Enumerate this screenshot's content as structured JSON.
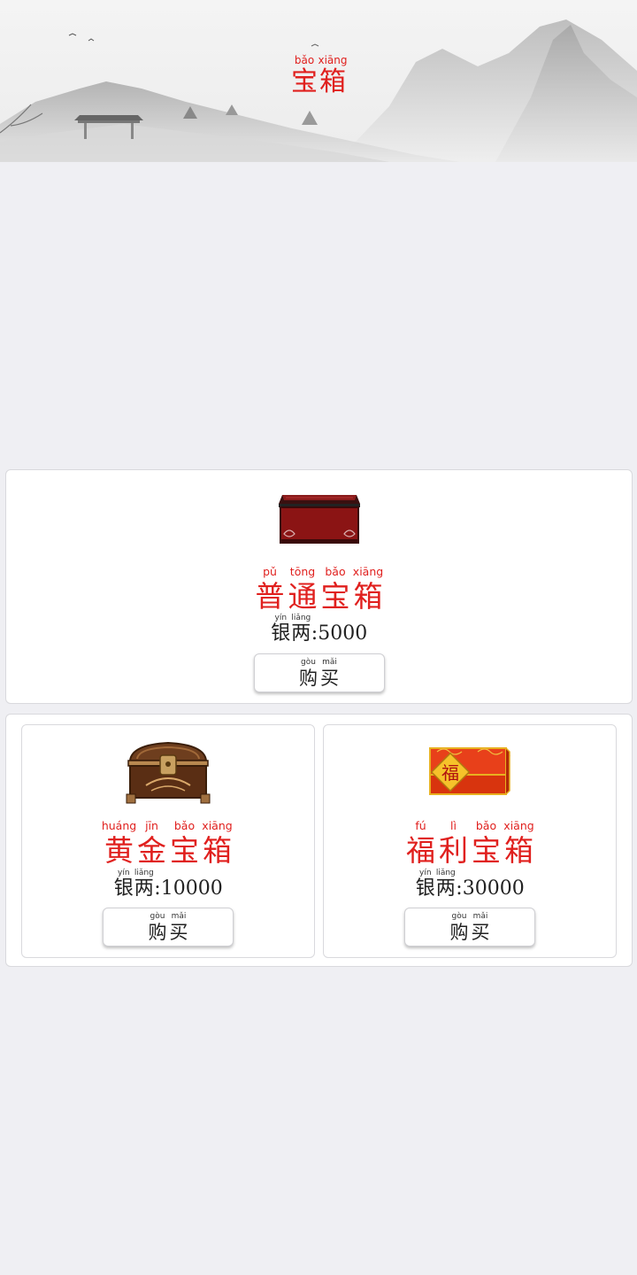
{
  "header": {
    "title": [
      {
        "py": "bǎo",
        "hz": "宝"
      },
      {
        "py": "xiāng",
        "hz": "箱"
      }
    ]
  },
  "chests": [
    {
      "name": [
        {
          "py": "pǔ",
          "hz": "普"
        },
        {
          "py": "tōng",
          "hz": "通"
        },
        {
          "py": "bǎo",
          "hz": "宝"
        },
        {
          "py": "xiāng",
          "hz": "箱"
        }
      ],
      "price_label": [
        {
          "py": "yín",
          "hz": "银"
        },
        {
          "py": "liǎng",
          "hz": "两"
        }
      ],
      "price_sep": ":",
      "price": "5000",
      "buy": [
        {
          "py": "gòu",
          "hz": "购"
        },
        {
          "py": "mǎi",
          "hz": "买"
        }
      ],
      "icon": "red-chest-icon"
    },
    {
      "name": [
        {
          "py": "huáng",
          "hz": "黄"
        },
        {
          "py": "jīn",
          "hz": "金"
        },
        {
          "py": "bǎo",
          "hz": "宝"
        },
        {
          "py": "xiāng",
          "hz": "箱"
        }
      ],
      "price_label": [
        {
          "py": "yín",
          "hz": "银"
        },
        {
          "py": "liǎng",
          "hz": "两"
        }
      ],
      "price_sep": ":",
      "price": "10000",
      "buy": [
        {
          "py": "gòu",
          "hz": "购"
        },
        {
          "py": "mǎi",
          "hz": "买"
        }
      ],
      "icon": "wooden-chest-icon"
    },
    {
      "name": [
        {
          "py": "fú",
          "hz": "福"
        },
        {
          "py": "lì",
          "hz": "利"
        },
        {
          "py": "bǎo",
          "hz": "宝"
        },
        {
          "py": "xiāng",
          "hz": "箱"
        }
      ],
      "price_label": [
        {
          "py": "yín",
          "hz": "银"
        },
        {
          "py": "liǎng",
          "hz": "两"
        }
      ],
      "price_sep": ":",
      "price": "30000",
      "buy": [
        {
          "py": "gòu",
          "hz": "购"
        },
        {
          "py": "mǎi",
          "hz": "买"
        }
      ],
      "icon": "fortune-box-icon",
      "emblem": "福"
    }
  ],
  "colors": {
    "accent_red": "#e0201e",
    "background": "#efeff3",
    "card": "#ffffff"
  }
}
